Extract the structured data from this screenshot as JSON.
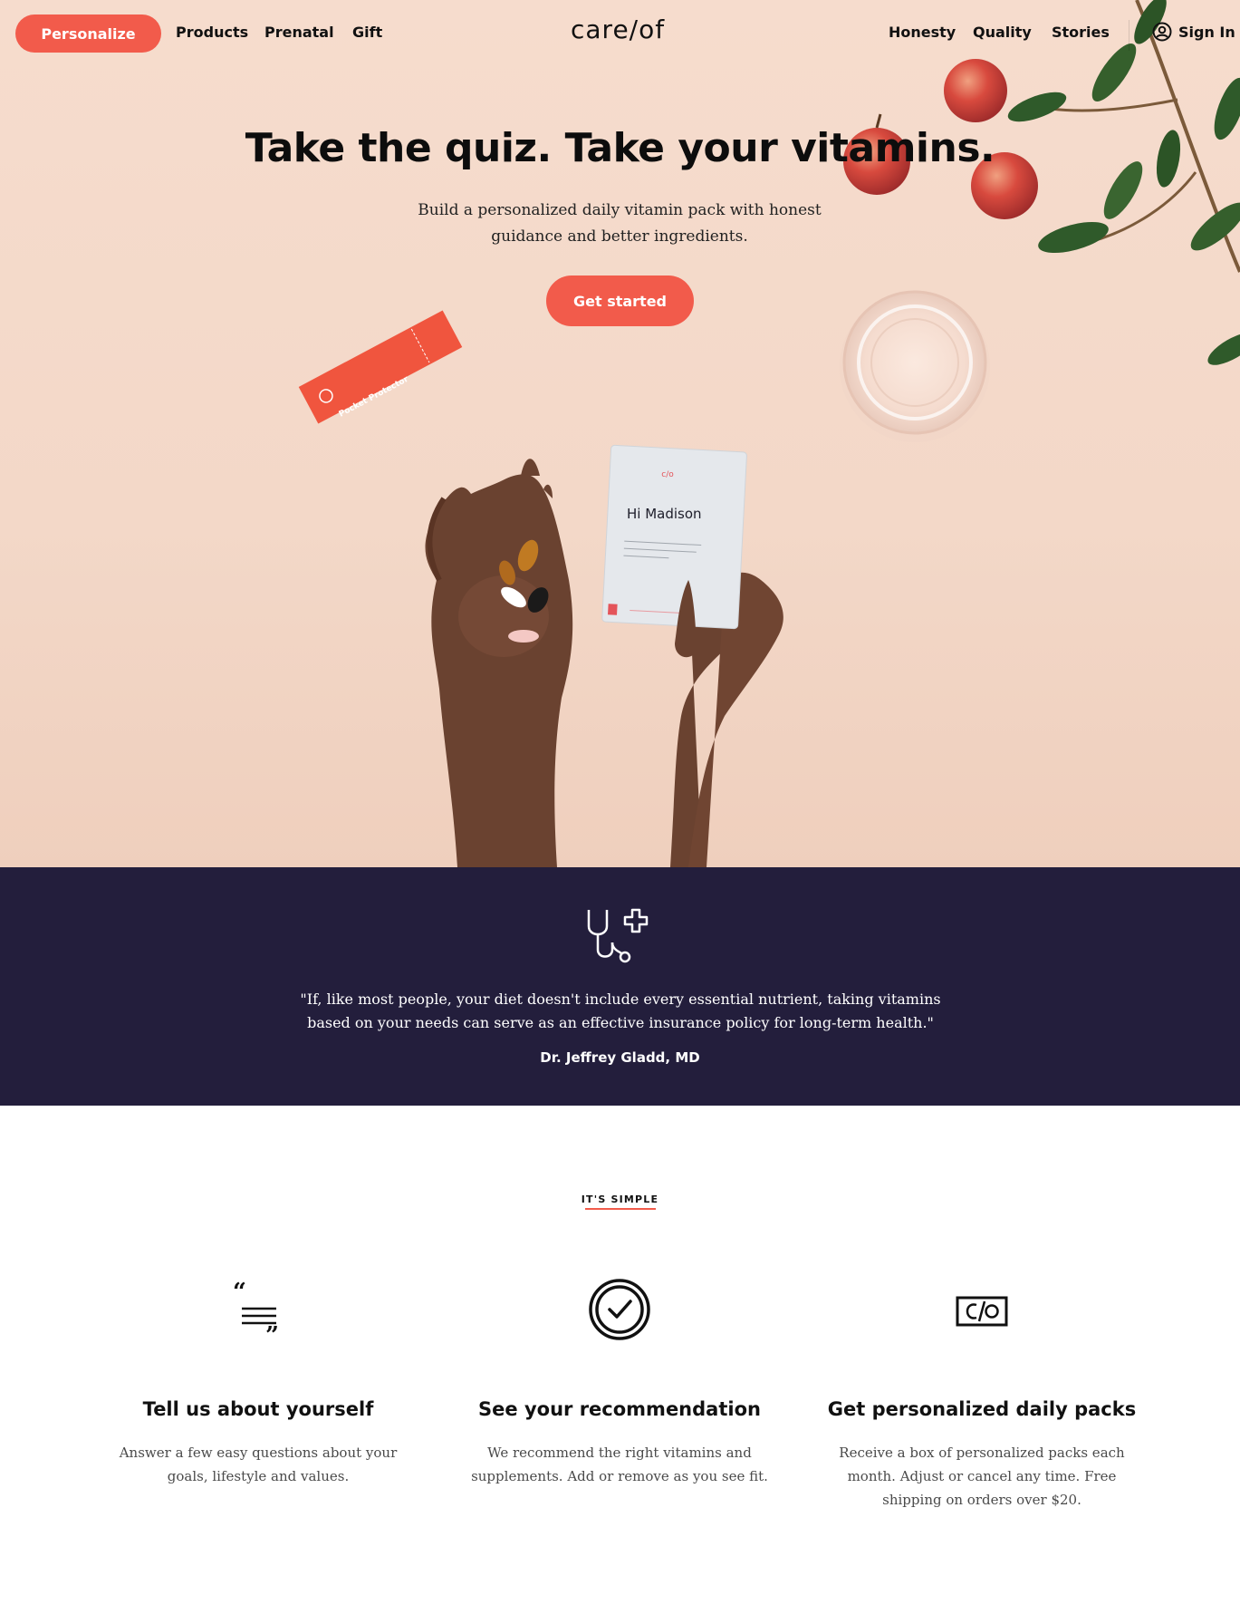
{
  "nav": {
    "personalize": "Personalize",
    "left_links": [
      "Products",
      "Prenatal",
      "Gift"
    ],
    "logo": "care/of",
    "right_links": [
      "Honesty",
      "Quality",
      "Stories"
    ],
    "sign_in": "Sign In"
  },
  "hero": {
    "title": "Take the quiz. Take your vitamins.",
    "subtitle": "Build a personalized daily vitamin pack with honest guidance and better ingredients.",
    "cta": "Get started",
    "packet_brand": "c/o",
    "packet_greeting": "Hi Madison",
    "stick_label": "Pocket Protector"
  },
  "quote": {
    "text": "\"If, like most people, your diet doesn't include every essential nutrient, taking vitamins based on your needs can serve as an effective insurance policy for long-term health.\"",
    "author": "Dr. Jeffrey Gladd, MD"
  },
  "simple": {
    "kicker": "IT'S SIMPLE",
    "steps": [
      {
        "icon": "quote-lines-icon",
        "title": "Tell us about yourself",
        "desc": "Answer a few easy questions about your goals, lifestyle and values."
      },
      {
        "icon": "check-circle-icon",
        "title": "See your recommendation",
        "desc": "We recommend the right vitamins and supplements. Add or remove as you see fit."
      },
      {
        "icon": "careof-box-icon",
        "title": "Get personalized daily packs",
        "desc": "Receive a box of personalized packs each month. Adjust or cancel any time. Free shipping on orders over $20."
      }
    ]
  },
  "colors": {
    "accent": "#f25b4b",
    "hero_bg": "#f6dccd",
    "band_bg": "#231e3c"
  }
}
